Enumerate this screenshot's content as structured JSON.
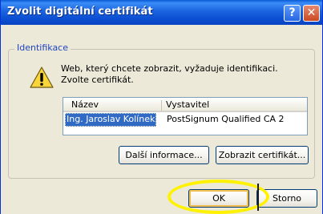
{
  "window": {
    "title": "Zvolit digitální certifikát",
    "help_glyph": "?",
    "close_glyph": "✕"
  },
  "group": {
    "label": "Identifikace",
    "message_line1": "Web, který chcete zobrazit, vyžaduje identifikaci.",
    "message_line2": "Zvolte certifikát."
  },
  "certificates": {
    "columns": [
      "Název",
      "Vystavitel"
    ],
    "rows": [
      {
        "name": "Ing. Jaroslav Kolínek",
        "issuer": "PostSignum Qualified CA 2",
        "selected": true
      }
    ]
  },
  "buttons": {
    "more_info": "Další informace...",
    "show_cert": "Zobrazit certifikát...",
    "ok": "OK",
    "cancel": "Storno"
  },
  "colors": {
    "titlebar": "#0a4ccf",
    "selection": "#316ac5",
    "highlight_ring": "#fff200",
    "group_label": "#1f44c2"
  },
  "icons": {
    "warning": "warning-icon",
    "help": "help-icon",
    "close": "close-icon"
  }
}
